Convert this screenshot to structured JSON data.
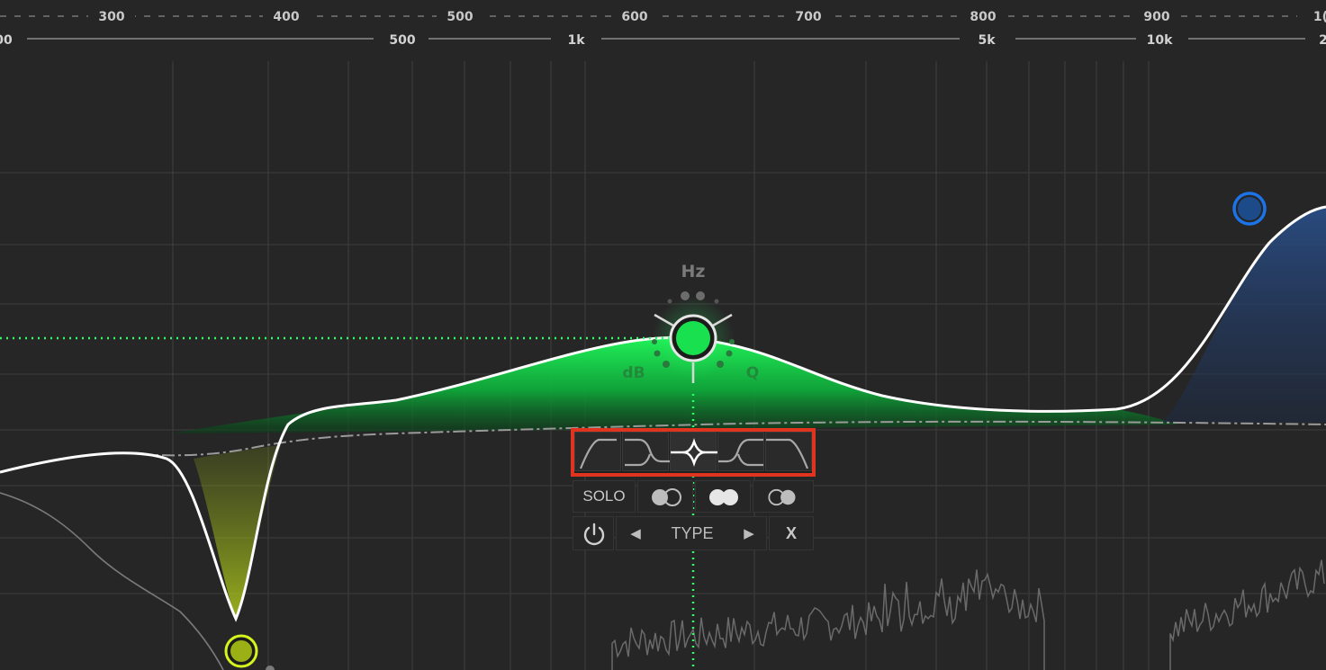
{
  "freq_ruler_top": {
    "labels": [
      "300",
      "400",
      "500",
      "600",
      "700",
      "800",
      "900",
      "1("
    ]
  },
  "freq_ruler_bottom": {
    "labels": [
      "00",
      "500",
      "1k",
      "5k",
      "10k",
      "2"
    ]
  },
  "nodes": {
    "main": {
      "hz_label": "Hz",
      "db_label": "dB",
      "q_label": "Q",
      "color": "#19e04f"
    },
    "notch": {
      "color": "#c4e817"
    },
    "high_shelf": {
      "color": "#1b74e8"
    }
  },
  "band_panel": {
    "filter_types": [
      "low-cut-icon",
      "low-shelf-icon",
      "bell-icon",
      "high-shelf-icon",
      "band-pass-icon"
    ],
    "selected_type": "bell-icon",
    "solo_label": "SOLO",
    "type_label": "TYPE",
    "prev_arrow": "◀",
    "next_arrow": "▶",
    "close_label": "X"
  },
  "colors": {
    "background": "#262626",
    "grid": "#3e3e3e",
    "curve": "#ffffff",
    "bell_fill": "#19e04f",
    "shelf_fill": "#1f3a66",
    "highlight": "#e0341f"
  }
}
